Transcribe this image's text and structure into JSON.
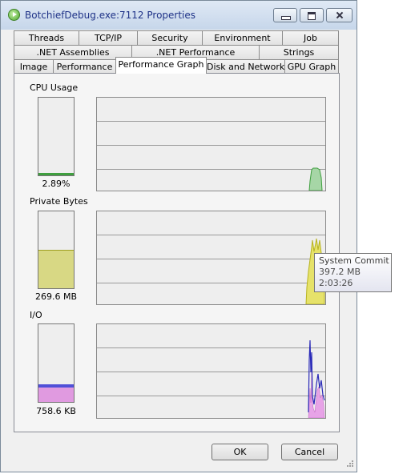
{
  "window": {
    "title": "BotchiefDebug.exe:7112 Properties"
  },
  "tabs": {
    "row1": [
      "Threads",
      "TCP/IP",
      "Security",
      "Environment",
      "Job"
    ],
    "row2": [
      ".NET Assemblies",
      ".NET Performance",
      "Strings"
    ],
    "row3": [
      "Image",
      "Performance",
      "Performance Graph",
      "Disk and Network",
      "GPU Graph"
    ],
    "active": "Performance Graph"
  },
  "cpu": {
    "label": "CPU Usage",
    "value": "2.89%",
    "fraction": 0.0289,
    "fill": "#3f9f3f"
  },
  "private_bytes": {
    "label": "Private Bytes",
    "value": "269.6 MB",
    "fraction": 0.49,
    "fill": "#d8d884"
  },
  "io": {
    "label": "I/O",
    "value": "758.6  KB",
    "fraction": 0.23,
    "fill_top": "#5050d8",
    "fill": "#e09ae0"
  },
  "tooltip": {
    "title": "System Commit",
    "value": "397.2 MB",
    "time": "2:03:26"
  },
  "buttons": {
    "ok": "OK",
    "cancel": "Cancel"
  },
  "colors": {
    "cpu_graph": "#3f9f3f",
    "memory_graph": "#d4d040",
    "io_read": "#e090e0",
    "io_other": "#3030c0"
  }
}
